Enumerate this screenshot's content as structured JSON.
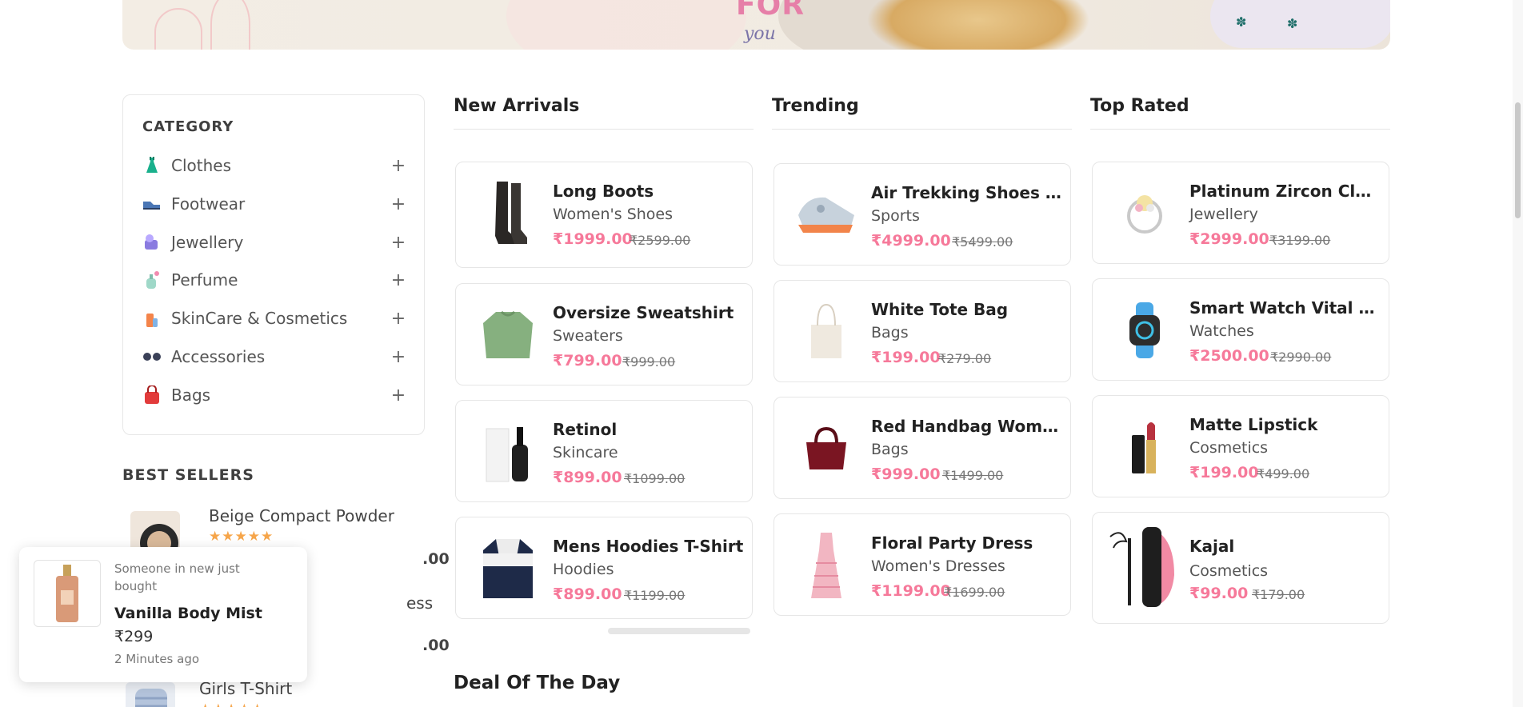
{
  "banner": {
    "line1": "FOR",
    "line2": "you"
  },
  "category": {
    "title": "CATEGORY",
    "items": [
      {
        "label": "Clothes",
        "icon": "dress-icon"
      },
      {
        "label": "Footwear",
        "icon": "shoe-icon"
      },
      {
        "label": "Jewellery",
        "icon": "jewellery-icon"
      },
      {
        "label": "Perfume",
        "icon": "perfume-icon"
      },
      {
        "label": "SkinCare & Cosmetics",
        "icon": "cosmetics-icon"
      },
      {
        "label": "Accessories",
        "icon": "glasses-icon"
      },
      {
        "label": "Bags",
        "icon": "bag-icon"
      }
    ],
    "expand": "+"
  },
  "best_sellers": {
    "title": "BEST SELLERS",
    "items": [
      {
        "name": "Beige Compact Powder",
        "stars": "★★★★★",
        "price": ".00"
      },
      {
        "name": "ess",
        "price": ".00"
      },
      {
        "name": "Girls T-Shirt",
        "stars": "★★★★★"
      }
    ]
  },
  "columns": {
    "new_arrivals": {
      "title": "New Arrivals",
      "products": [
        {
          "title": "Long Boots",
          "category": "Women's Shoes",
          "price": "₹1999.00",
          "old": "₹2599.00"
        },
        {
          "title": "Oversize Sweatshirt",
          "category": "Sweaters",
          "price": "₹799.00",
          "old": "₹999.00"
        },
        {
          "title": "Retinol",
          "category": "Skincare",
          "price": "₹899.00",
          "old": "₹1099.00"
        },
        {
          "title": "Mens Hoodies T-Shirt",
          "category": "Hoodies",
          "price": "₹899.00",
          "old": "₹1199.00"
        }
      ]
    },
    "trending": {
      "title": "Trending",
      "products": [
        {
          "title": "Air Trekking Shoes Women",
          "category": "Sports",
          "price": "₹4999.00",
          "old": "₹5499.00"
        },
        {
          "title": "White Tote Bag",
          "category": "Bags",
          "price": "₹199.00",
          "old": "₹279.00"
        },
        {
          "title": "Red Handbag Women",
          "category": "Bags",
          "price": "₹999.00",
          "old": "₹1499.00"
        },
        {
          "title": "Floral Party Dress",
          "category": "Women's Dresses",
          "price": "₹1199.00",
          "old": "₹1699.00"
        }
      ]
    },
    "top_rated": {
      "title": "Top Rated",
      "products": [
        {
          "title": "Platinum Zircon Classic Ring",
          "category": "Jewellery",
          "price": "₹2999.00",
          "old": "₹3199.00"
        },
        {
          "title": "Smart Watch Vital Plus",
          "category": "Watches",
          "price": "₹2500.00",
          "old": "₹2990.00"
        },
        {
          "title": "Matte Lipstick",
          "category": "Cosmetics",
          "price": "₹199.00",
          "old": "₹499.00"
        },
        {
          "title": "Kajal",
          "category": "Cosmetics",
          "price": "₹99.00",
          "old": "₹179.00"
        }
      ]
    }
  },
  "deal": {
    "title": "Deal Of The Day"
  },
  "toast": {
    "message": "Someone in new just bought",
    "product": "Vanilla Body Mist",
    "price": "₹299",
    "time": "2 Minutes ago"
  },
  "colors": {
    "accent": "#f6799a",
    "star": "#f6a54a"
  }
}
